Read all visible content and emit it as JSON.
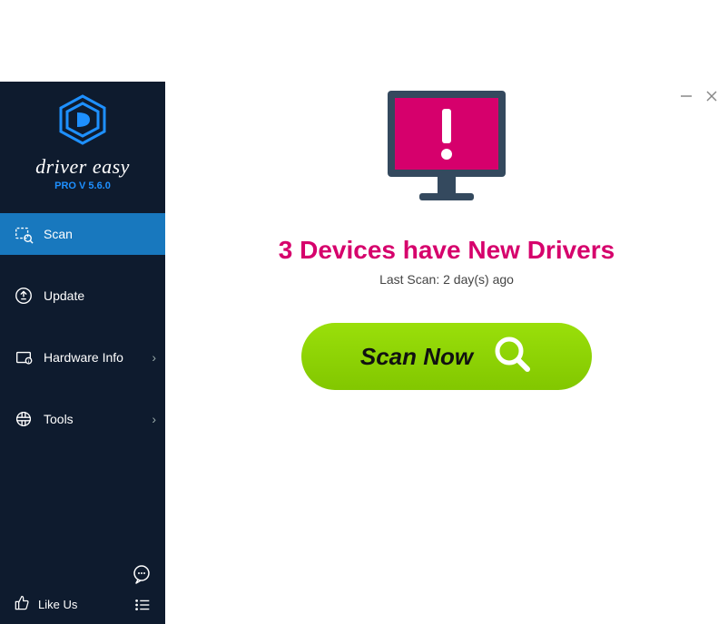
{
  "app": {
    "brand": "driver easy",
    "version": "PRO V 5.6.0"
  },
  "sidebar": {
    "items": [
      {
        "label": "Scan"
      },
      {
        "label": "Update"
      },
      {
        "label": "Hardware Info"
      },
      {
        "label": "Tools"
      }
    ],
    "like_label": "Like Us"
  },
  "main": {
    "status_title": "3 Devices have New Drivers",
    "last_scan": "Last Scan: 2 day(s) ago",
    "scan_button": "Scan Now"
  },
  "colors": {
    "accent": "#1878be",
    "status": "#d6006c",
    "scan": "#8fce00"
  }
}
